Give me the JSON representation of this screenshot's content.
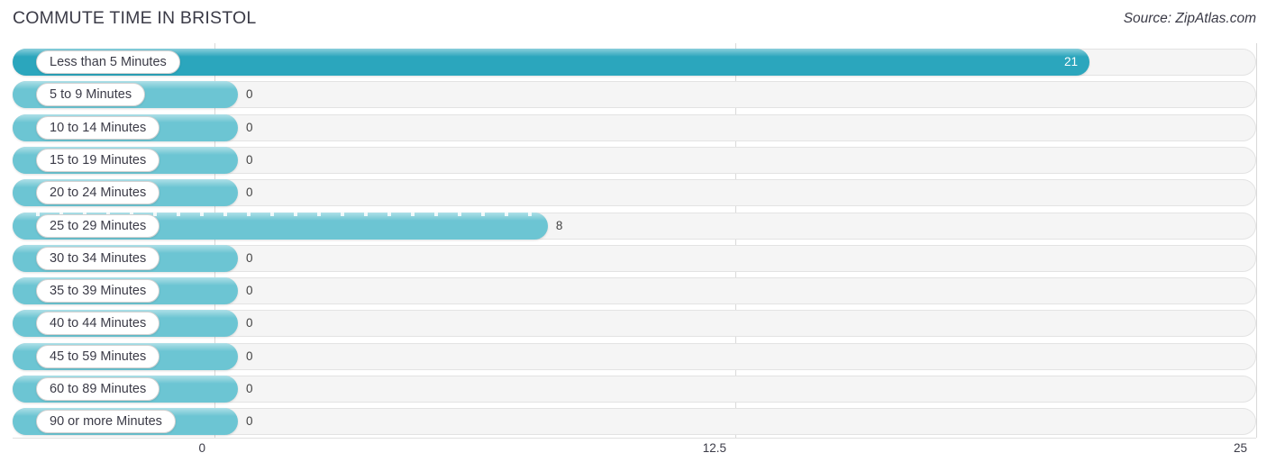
{
  "header": {
    "title": "COMMUTE TIME IN BRISTOL",
    "source": "Source: ZipAtlas.com"
  },
  "colors": {
    "bar_primary": "#2ba6bd",
    "bar_secondary": "#6cc5d3",
    "track": "#f5f5f5",
    "gridline": "#d9d9d9",
    "text": "#3b3b47"
  },
  "chart_data": {
    "type": "bar",
    "orientation": "horizontal",
    "title": "COMMUTE TIME IN BRISTOL",
    "xlabel": "",
    "ylabel": "",
    "xlim": [
      0,
      25
    ],
    "grid": true,
    "legend": null,
    "ticks": [
      "0",
      "12.5",
      "25"
    ],
    "tick_values": [
      0,
      12.5,
      25
    ],
    "categories": [
      "Less than 5 Minutes",
      "5 to 9 Minutes",
      "10 to 14 Minutes",
      "15 to 19 Minutes",
      "20 to 24 Minutes",
      "25 to 29 Minutes",
      "30 to 34 Minutes",
      "35 to 39 Minutes",
      "40 to 44 Minutes",
      "45 to 59 Minutes",
      "60 to 89 Minutes",
      "90 or more Minutes"
    ],
    "values": [
      21,
      0,
      0,
      0,
      0,
      8,
      0,
      0,
      0,
      0,
      0,
      0
    ],
    "value_labels": [
      "21",
      "0",
      "0",
      "0",
      "0",
      "8",
      "0",
      "0",
      "0",
      "0",
      "0",
      "0"
    ]
  },
  "rows": [
    {
      "label": "Less than 5 Minutes",
      "value": "21",
      "highlight": true
    },
    {
      "label": "5 to 9 Minutes",
      "value": "0",
      "highlight": false
    },
    {
      "label": "10 to 14 Minutes",
      "value": "0",
      "highlight": false
    },
    {
      "label": "15 to 19 Minutes",
      "value": "0",
      "highlight": false
    },
    {
      "label": "20 to 24 Minutes",
      "value": "0",
      "highlight": false
    },
    {
      "label": "25 to 29 Minutes",
      "value": "8",
      "highlight": false
    },
    {
      "label": "30 to 34 Minutes",
      "value": "0",
      "highlight": false
    },
    {
      "label": "35 to 39 Minutes",
      "value": "0",
      "highlight": false
    },
    {
      "label": "40 to 44 Minutes",
      "value": "0",
      "highlight": false
    },
    {
      "label": "45 to 59 Minutes",
      "value": "0",
      "highlight": false
    },
    {
      "label": "60 to 89 Minutes",
      "value": "0",
      "highlight": false
    },
    {
      "label": "90 or more Minutes",
      "value": "0",
      "highlight": false
    }
  ]
}
